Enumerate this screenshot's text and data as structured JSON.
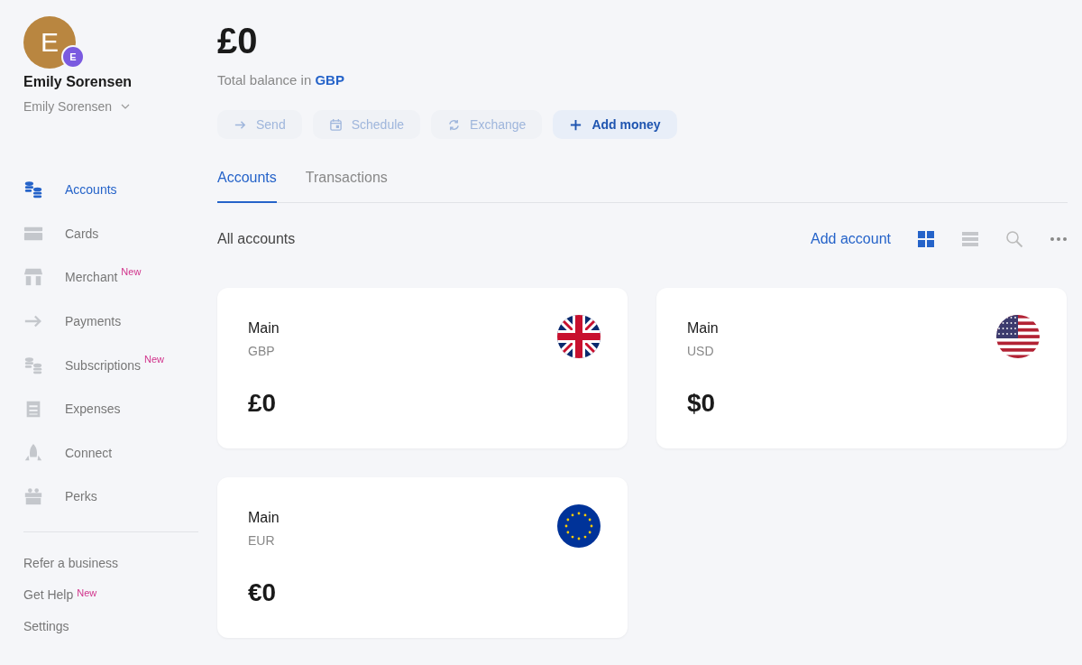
{
  "profile": {
    "initial": "E",
    "badge_initial": "E",
    "name": "Emily Sorensen",
    "account_switcher": "Emily Sorensen"
  },
  "nav": [
    {
      "label": "Accounts",
      "selected": true
    },
    {
      "label": "Cards",
      "selected": false
    },
    {
      "label": "Merchant",
      "selected": false,
      "badge": "New"
    },
    {
      "label": "Payments",
      "selected": false
    },
    {
      "label": "Subscriptions",
      "selected": false,
      "badge": "New"
    },
    {
      "label": "Expenses",
      "selected": false
    },
    {
      "label": "Connect",
      "selected": false
    },
    {
      "label": "Perks",
      "selected": false
    }
  ],
  "footer_links": [
    {
      "label": "Refer a business"
    },
    {
      "label": "Get Help",
      "badge": "New"
    },
    {
      "label": "Settings"
    }
  ],
  "balance": {
    "amount": "£0",
    "caption": "Total balance in",
    "currency": "GBP"
  },
  "actions": [
    {
      "label": "Send",
      "disabled": true
    },
    {
      "label": "Schedule",
      "disabled": true
    },
    {
      "label": "Exchange",
      "disabled": true
    },
    {
      "label": "Add money",
      "disabled": false
    }
  ],
  "tabs": [
    {
      "label": "Accounts",
      "selected": true
    },
    {
      "label": "Transactions",
      "selected": false
    }
  ],
  "section": {
    "title": "All accounts",
    "add_link": "Add account"
  },
  "view_modes": [
    {
      "kind": "grid",
      "selected": true
    },
    {
      "kind": "list",
      "selected": false
    }
  ],
  "accounts": [
    {
      "name": "Main",
      "currency": "GBP",
      "balance": "£0"
    },
    {
      "name": "Main",
      "currency": "USD",
      "balance": "$0"
    },
    {
      "name": "Main",
      "currency": "EUR",
      "balance": "€0"
    }
  ]
}
